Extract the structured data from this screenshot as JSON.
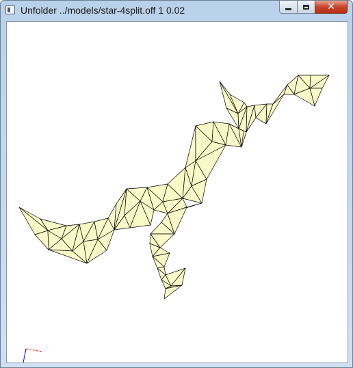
{
  "window": {
    "title": "Unfolder ../models/star-4split.off 1 0.02",
    "controls": {
      "minimize_icon": "minimize-icon",
      "maximize_icon": "maximize-icon",
      "close_glyph": "✕"
    }
  },
  "viewport": {
    "face_fill": "#fafac8",
    "edge_color": "#000000",
    "axis_x_color": "#ff0000",
    "axis_y_color": "#0000ff"
  }
}
